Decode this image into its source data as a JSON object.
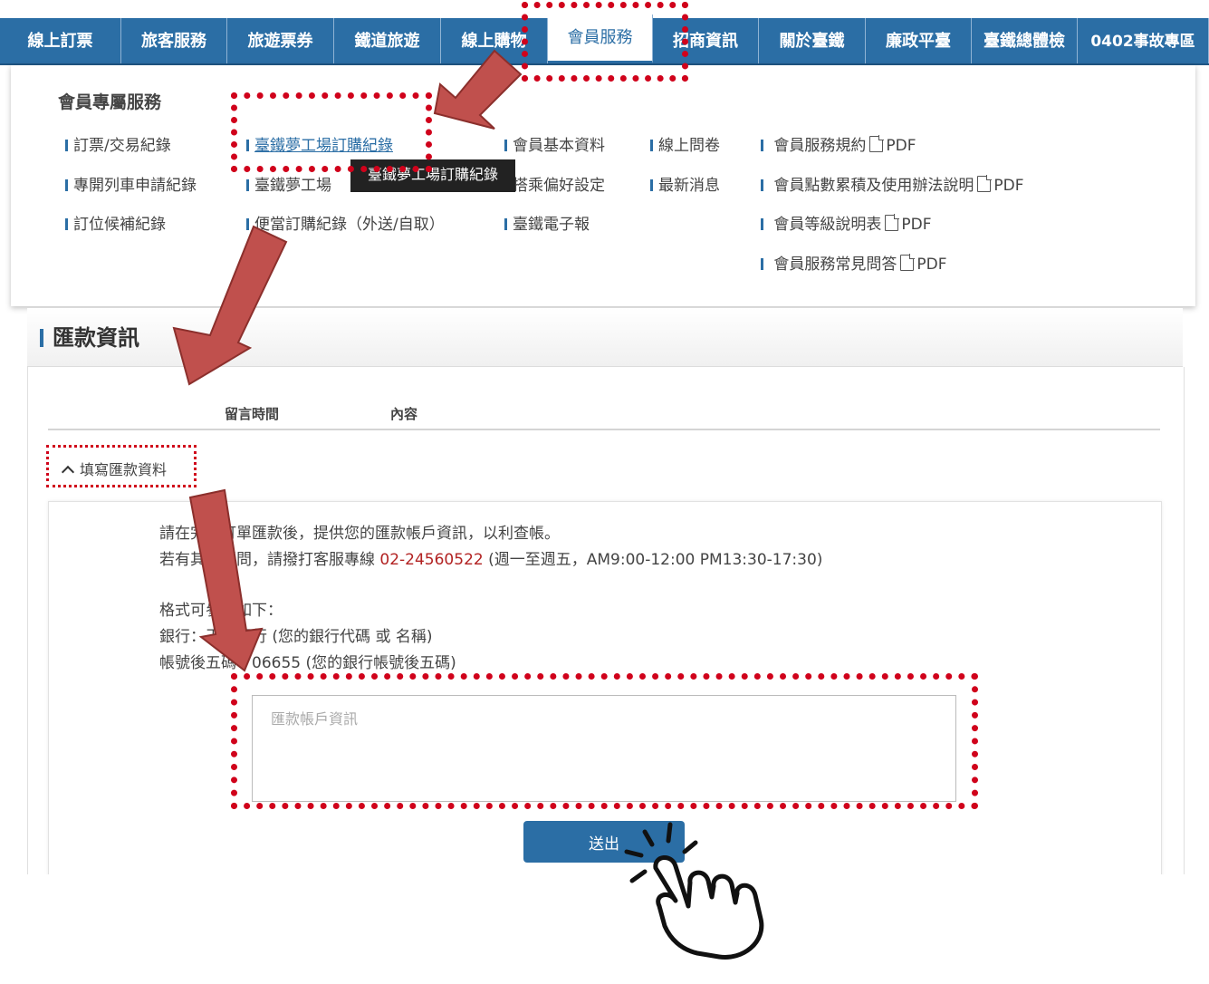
{
  "nav": {
    "items": [
      "線上訂票",
      "旅客服務",
      "旅遊票券",
      "鐵道旅遊",
      "線上購物",
      "會員服務",
      "招商資訊",
      "關於臺鐵",
      "廉政平臺",
      "臺鐵總體檢",
      "0402事故專區"
    ],
    "active": "會員服務"
  },
  "mega": {
    "title": "會員專屬服務",
    "col1": [
      "訂票/交易紀錄",
      "專開列車申請紀錄",
      "訂位候補紀錄"
    ],
    "col2": [
      "臺鐵夢工場訂購紀錄",
      "臺鐵夢工場",
      "便當訂購紀錄（外送/自取）"
    ],
    "col3": [
      "會員基本資料",
      "搭乘偏好設定",
      "臺鐵電子報"
    ],
    "col4": [
      "線上問卷",
      "最新消息"
    ],
    "col5": [
      "會員服務規約",
      "會員點數累積及使用辦法說明",
      "會員等級說明表",
      "會員服務常見問答"
    ],
    "pdf_label": "PDF",
    "tooltip": "臺鐵夢工場訂購紀錄"
  },
  "panel": {
    "title": "匯款資訊",
    "col_time": "留言時間",
    "col_content": "內容",
    "toggle_label": "填寫匯款資料",
    "line1": "請在完成訂單匯款後，提供您的匯款帳戶資訊，以利查帳。",
    "line2_prefix": "若有其他疑問，請撥打客服專線 ",
    "phone": "02-24560522",
    "line2_suffix": " (週一至週五，AM9:00-12:00 PM13:30-17:30)",
    "line3": "格式可參考如下：",
    "line4": "銀行：玉山銀行 (您的銀行代碼 或 名稱)",
    "line5": "帳號後五碼：06655 (您的銀行帳號後五碼)",
    "textarea_placeholder": "匯款帳戶資訊",
    "submit_label": "送出"
  },
  "colors": {
    "nav_blue": "#2b6ea5",
    "annotation_red": "#d0021b",
    "arrow_red": "#c0504d"
  }
}
